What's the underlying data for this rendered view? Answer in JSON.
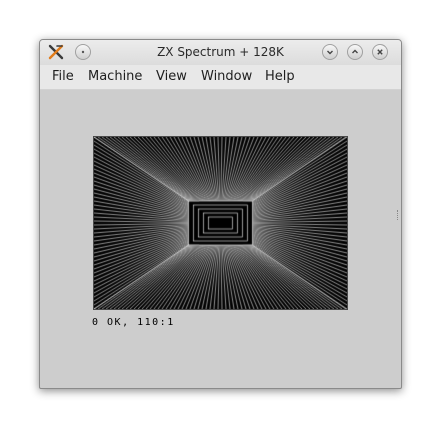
{
  "window": {
    "title": "ZX Spectrum + 128K",
    "app_icon": "x-logo-icon",
    "title_buttons": [
      "minimize-icon",
      "restore-icon",
      "close-icon"
    ],
    "chrome_color": "#e8e8e8",
    "body_color": "#cdcdcd"
  },
  "menu": {
    "file": "File",
    "machine": "Machine",
    "view": "View",
    "window": "Window",
    "help": "Help"
  },
  "screen": {
    "ink_color": "#ffffff",
    "paper_color": "#000000",
    "pattern": "moire"
  },
  "status": {
    "text": "0 OK, 110:1"
  }
}
